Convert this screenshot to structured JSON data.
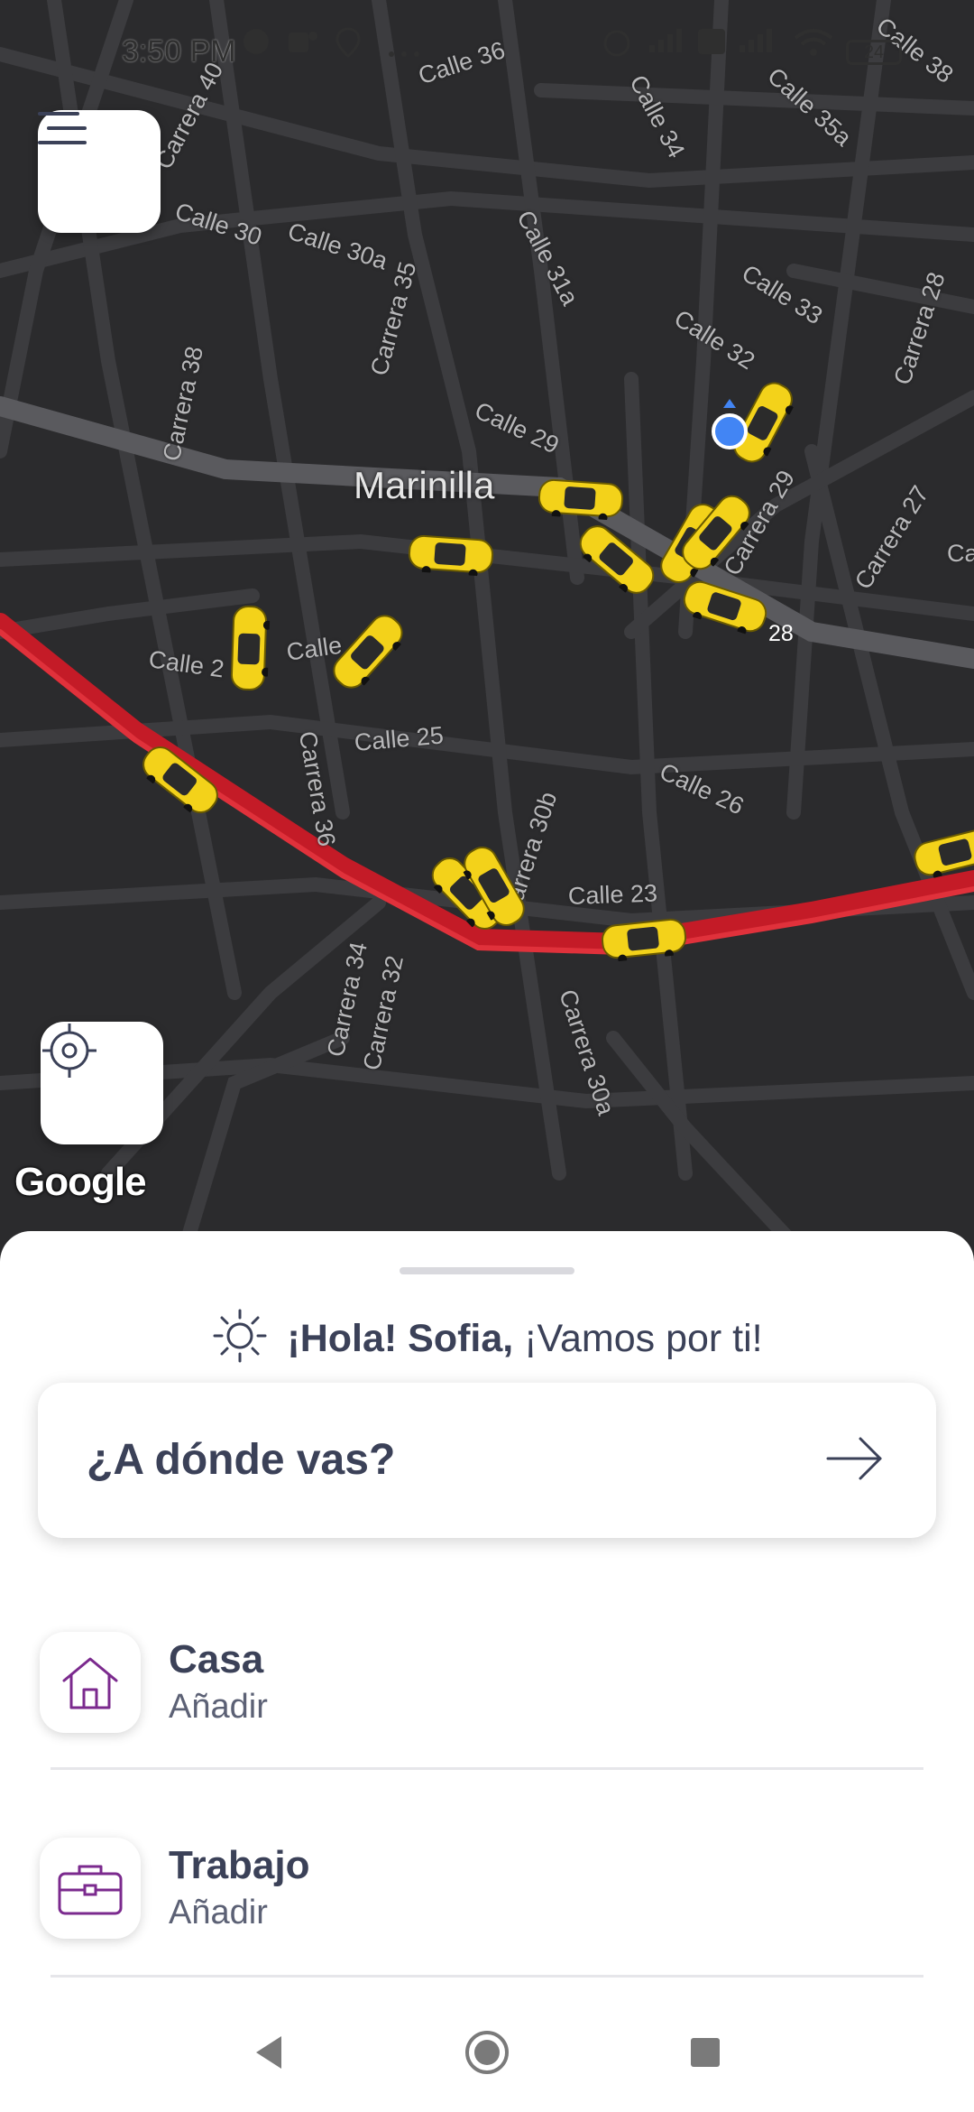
{
  "status_bar": {
    "time": "3:50 PM",
    "battery": "24",
    "icons": [
      "messenger-icon",
      "teams-icon",
      "location-pin-icon",
      "more-dots-icon",
      "alarm-icon",
      "signal-icon",
      "volte-icon",
      "signal-icon",
      "wifi-icon",
      "battery-icon"
    ]
  },
  "map": {
    "city": "Marinilla",
    "streets": [
      "Calle 36",
      "Carrera 40",
      "Calle 30",
      "Calle 30a",
      "Carrera 35",
      "Calle 31a",
      "Calle 34",
      "Calle 35a",
      "Calle 38",
      "Calle 33",
      "Carrera 28",
      "Calle 32",
      "Carrera 38",
      "Calle 29",
      "Carrera 29",
      "Carrera 27",
      "Calle 2",
      "Calle",
      "Carrera 36",
      "Calle 25",
      "Calle 26",
      "Carrera 30b",
      "Calle 23",
      "Carrera 34",
      "Carrera 32",
      "Carrera 30a",
      "Ca"
    ],
    "road_number": "28",
    "attribution": "Google"
  },
  "controls": {
    "menu_icon": "menu-icon",
    "locate_icon": "crosshair-icon"
  },
  "sheet": {
    "greeting_name": "¡Hola! Sofia,",
    "greeting_rest": " ¡Vamos por ti!",
    "search_label": "¿A dónde vas?",
    "places": [
      {
        "title": "Casa",
        "subtitle": "Añadir",
        "icon": "home-icon"
      },
      {
        "title": "Trabajo",
        "subtitle": "Añadir",
        "icon": "briefcase-icon"
      }
    ]
  },
  "colors": {
    "map_bg": "#2b2b2d",
    "road": "#3b3b3e",
    "highway": "#cc1f2a",
    "taxi": "#f3d21a",
    "text_primary": "#3b4158",
    "accent_purple": "#7b2a8e",
    "location_dot": "#4285f4"
  }
}
